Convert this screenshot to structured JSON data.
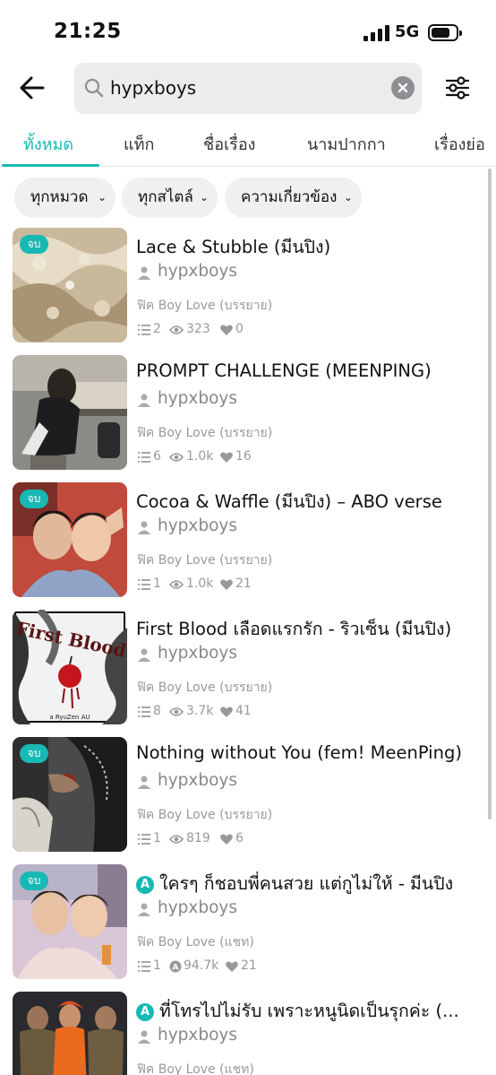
{
  "status_bar": {
    "time": "21:25",
    "network": "5G"
  },
  "search": {
    "query": "hypxboys"
  },
  "tabs": [
    {
      "label": "ทั้งหมด",
      "active": true
    },
    {
      "label": "แท็ก",
      "active": false
    },
    {
      "label": "ชื่อเรื่อง",
      "active": false
    },
    {
      "label": "นามปากกา",
      "active": false
    },
    {
      "label": "เรื่องย่อ",
      "active": false
    }
  ],
  "filters": [
    {
      "label": "ทุกหมวด"
    },
    {
      "label": "ทุกสไตล์"
    },
    {
      "label": "ความเกี่ยวข้อง"
    }
  ],
  "colors": {
    "accent": "#17b9b4",
    "muted_text": "#999999"
  },
  "stories": [
    {
      "badge": "จบ",
      "title": "Lace & Stubble (มีนปิง)",
      "ai": false,
      "author": "hypxboys",
      "category": "ฟิค Boy Love (บรรยาย)",
      "chapters": "2",
      "views": "323",
      "likes": "0",
      "views_icon": "eye-icon"
    },
    {
      "badge": "",
      "title": "PROMPT CHALLENGE (MEENPING)",
      "ai": false,
      "author": "hypxboys",
      "category": "ฟิค Boy Love (บรรยาย)",
      "chapters": "6",
      "views": "1.0k",
      "likes": "16",
      "views_icon": "eye-icon"
    },
    {
      "badge": "จบ",
      "title": "Cocoa & Waffle (มีนปิง) – ABO verse",
      "ai": false,
      "author": "hypxboys",
      "category": "ฟิค Boy Love (บรรยาย)",
      "chapters": "1",
      "views": "1.0k",
      "likes": "21",
      "views_icon": "eye-icon"
    },
    {
      "badge": "",
      "title": "First Blood เลือดแรกรัก - ริวเซ็น (มีนปิง)",
      "ai": false,
      "author": "hypxboys",
      "category": "ฟิค Boy Love (บรรยาย)",
      "chapters": "8",
      "views": "3.7k",
      "likes": "41",
      "views_icon": "eye-icon"
    },
    {
      "badge": "จบ",
      "title": "Nothing without You (fem! MeenPing)",
      "ai": false,
      "author": "hypxboys",
      "category": "ฟิค Boy Love (บรรยาย)",
      "chapters": "1",
      "views": "819",
      "likes": "6",
      "views_icon": "eye-icon"
    },
    {
      "badge": "จบ",
      "title": "ใครๆ ก็ชอบพี่คนสวย แต่กูไม่ให้ - มีนปิง",
      "ai": true,
      "author": "hypxboys",
      "category": "ฟิค Boy Love (แชท)",
      "chapters": "1",
      "views": "94.7k",
      "likes": "21",
      "views_icon": "ai-view-icon"
    },
    {
      "badge": "",
      "title": "ที่โทรไปไม่รับ เพราะหนูนิดเป็นรุกค่ะ (...",
      "ai": true,
      "author": "hypxboys",
      "category": "ฟิค Boy Love (แชท)",
      "chapters": "",
      "views": "",
      "likes": "",
      "views_icon": "eye-icon"
    }
  ],
  "thumb_art": {
    "first_blood_title": "First Blood",
    "first_blood_sub": "a RyuZen AU"
  },
  "ai_badge": "A"
}
